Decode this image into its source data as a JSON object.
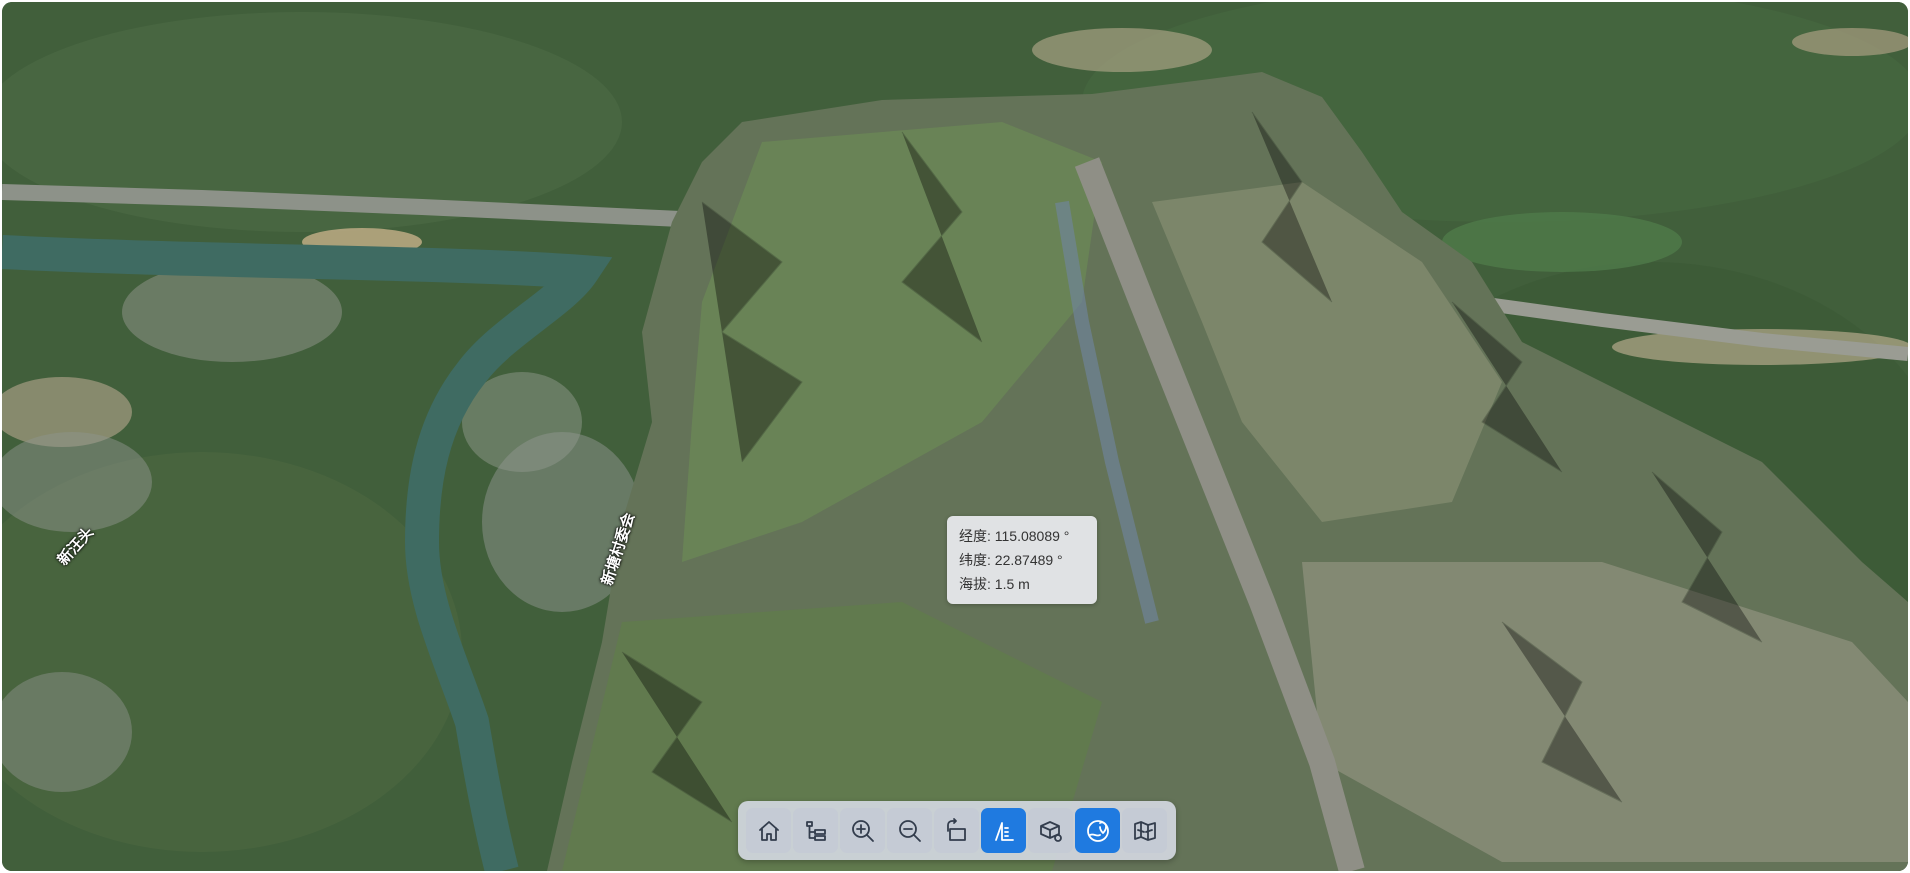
{
  "viewer": {
    "map_labels": [
      "新汪头",
      "新塘村委会"
    ],
    "tooltip": {
      "longitude": "经度: 115.08089 °",
      "latitude": "纬度: 22.87489 °",
      "altitude": "海拔: 1.5 m"
    }
  },
  "toolbar": {
    "buttons": [
      {
        "icon": "home-icon",
        "active": false
      },
      {
        "icon": "layer-tree-icon",
        "active": false
      },
      {
        "icon": "zoom-in-icon",
        "active": false
      },
      {
        "icon": "zoom-out-icon",
        "active": false
      },
      {
        "icon": "rotate-view-icon",
        "active": false
      },
      {
        "icon": "measure-icon",
        "active": true
      },
      {
        "icon": "3d-model-icon",
        "active": false
      },
      {
        "icon": "location-pick-icon",
        "active": true
      },
      {
        "icon": "map-icon",
        "active": false
      }
    ]
  },
  "colors": {
    "accent": "#1f7ae0",
    "toolbar_bg": "#d2d7e0",
    "tooltip_bg": "#eaecf0"
  }
}
